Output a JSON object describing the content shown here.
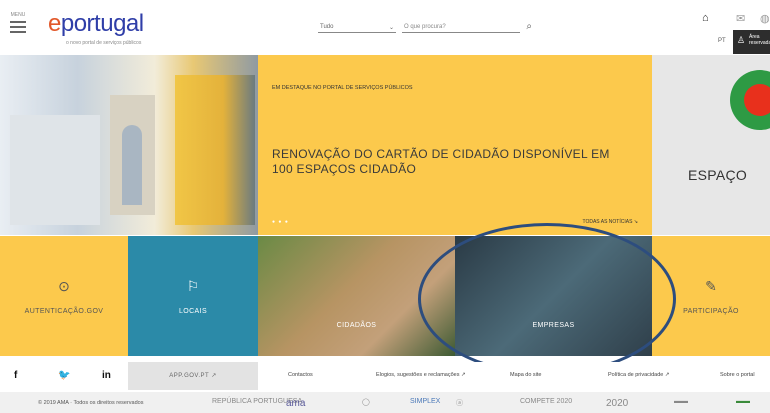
{
  "header": {
    "menu_label": "MENU",
    "logo_text": "portugal",
    "logo_e": "e",
    "logo_tagline": "o novo portal de serviços públicos",
    "search_select": "Tudo",
    "search_placeholder": "O que procura?",
    "lang": "PT",
    "area_label": "Área reservada"
  },
  "hero": {
    "kicker": "EM DESTAQUE NO PORTAL DE SERVIÇOS PÚBLICOS",
    "title": "RENOVAÇÃO DO CARTÃO DE CIDADÃO DISPONÍVEL EM 100 ESPAÇOS CIDADÃO",
    "dots": "● ● ●",
    "all_news": "TODAS AS NOTÍCIAS ↘",
    "right_text": "ESPAÇO"
  },
  "tiles": [
    {
      "label": "AUTENTICAÇÃO.GOV",
      "icon": "fingerprint-icon",
      "glyph": "⊙"
    },
    {
      "label": "LOCAIS",
      "icon": "map-icon",
      "glyph": "⚐"
    },
    {
      "label": "CIDADÃOS"
    },
    {
      "label": "EMPRESAS"
    },
    {
      "label": "PARTICIPAÇÃO",
      "icon": "edit-icon",
      "glyph": "✎"
    }
  ],
  "social": {
    "facebook": "f",
    "twitter": "🐦",
    "linkedin": "in"
  },
  "links": {
    "app_gov": "APP.GOV.PT ↗",
    "contactos": "Contactos",
    "elogios": "Elogios, sugestões e reclamações ↗",
    "mapa": "Mapa do site",
    "privacidade": "Política de privacidade ↗",
    "sobre": "Sobre o portal"
  },
  "footer": {
    "copyright": "© 2019 AMA · Todos os direitos reservados",
    "logos": [
      "REPÚBLICA PORTUGUESA",
      "ama",
      "◯",
      "SIMPLEX",
      "ⓐ",
      "COMPETE 2020",
      "2020",
      "▬▬",
      "▬▬"
    ]
  },
  "colors": {
    "yellow": "#fcc94c",
    "teal": "#2b8aa8",
    "oval": "#2d4d7e"
  }
}
